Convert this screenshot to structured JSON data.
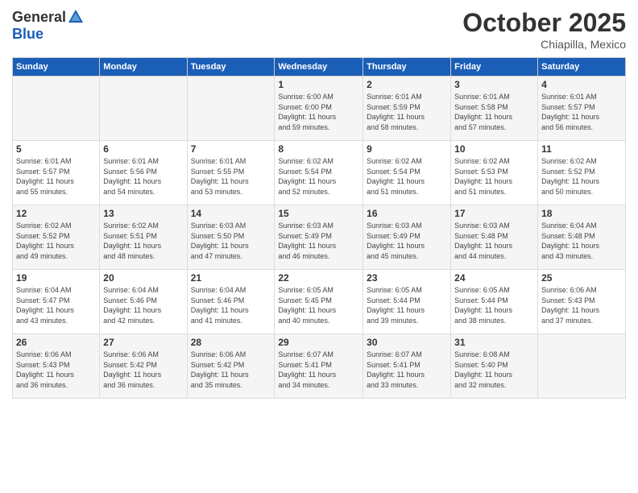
{
  "header": {
    "logo_general": "General",
    "logo_blue": "Blue",
    "month": "October 2025",
    "location": "Chiapilla, Mexico"
  },
  "weekdays": [
    "Sunday",
    "Monday",
    "Tuesday",
    "Wednesday",
    "Thursday",
    "Friday",
    "Saturday"
  ],
  "weeks": [
    [
      {
        "day": "",
        "info": ""
      },
      {
        "day": "",
        "info": ""
      },
      {
        "day": "",
        "info": ""
      },
      {
        "day": "1",
        "info": "Sunrise: 6:00 AM\nSunset: 6:00 PM\nDaylight: 11 hours\nand 59 minutes."
      },
      {
        "day": "2",
        "info": "Sunrise: 6:01 AM\nSunset: 5:59 PM\nDaylight: 11 hours\nand 58 minutes."
      },
      {
        "day": "3",
        "info": "Sunrise: 6:01 AM\nSunset: 5:58 PM\nDaylight: 11 hours\nand 57 minutes."
      },
      {
        "day": "4",
        "info": "Sunrise: 6:01 AM\nSunset: 5:57 PM\nDaylight: 11 hours\nand 56 minutes."
      }
    ],
    [
      {
        "day": "5",
        "info": "Sunrise: 6:01 AM\nSunset: 5:57 PM\nDaylight: 11 hours\nand 55 minutes."
      },
      {
        "day": "6",
        "info": "Sunrise: 6:01 AM\nSunset: 5:56 PM\nDaylight: 11 hours\nand 54 minutes."
      },
      {
        "day": "7",
        "info": "Sunrise: 6:01 AM\nSunset: 5:55 PM\nDaylight: 11 hours\nand 53 minutes."
      },
      {
        "day": "8",
        "info": "Sunrise: 6:02 AM\nSunset: 5:54 PM\nDaylight: 11 hours\nand 52 minutes."
      },
      {
        "day": "9",
        "info": "Sunrise: 6:02 AM\nSunset: 5:54 PM\nDaylight: 11 hours\nand 51 minutes."
      },
      {
        "day": "10",
        "info": "Sunrise: 6:02 AM\nSunset: 5:53 PM\nDaylight: 11 hours\nand 51 minutes."
      },
      {
        "day": "11",
        "info": "Sunrise: 6:02 AM\nSunset: 5:52 PM\nDaylight: 11 hours\nand 50 minutes."
      }
    ],
    [
      {
        "day": "12",
        "info": "Sunrise: 6:02 AM\nSunset: 5:52 PM\nDaylight: 11 hours\nand 49 minutes."
      },
      {
        "day": "13",
        "info": "Sunrise: 6:02 AM\nSunset: 5:51 PM\nDaylight: 11 hours\nand 48 minutes."
      },
      {
        "day": "14",
        "info": "Sunrise: 6:03 AM\nSunset: 5:50 PM\nDaylight: 11 hours\nand 47 minutes."
      },
      {
        "day": "15",
        "info": "Sunrise: 6:03 AM\nSunset: 5:49 PM\nDaylight: 11 hours\nand 46 minutes."
      },
      {
        "day": "16",
        "info": "Sunrise: 6:03 AM\nSunset: 5:49 PM\nDaylight: 11 hours\nand 45 minutes."
      },
      {
        "day": "17",
        "info": "Sunrise: 6:03 AM\nSunset: 5:48 PM\nDaylight: 11 hours\nand 44 minutes."
      },
      {
        "day": "18",
        "info": "Sunrise: 6:04 AM\nSunset: 5:48 PM\nDaylight: 11 hours\nand 43 minutes."
      }
    ],
    [
      {
        "day": "19",
        "info": "Sunrise: 6:04 AM\nSunset: 5:47 PM\nDaylight: 11 hours\nand 43 minutes."
      },
      {
        "day": "20",
        "info": "Sunrise: 6:04 AM\nSunset: 5:46 PM\nDaylight: 11 hours\nand 42 minutes."
      },
      {
        "day": "21",
        "info": "Sunrise: 6:04 AM\nSunset: 5:46 PM\nDaylight: 11 hours\nand 41 minutes."
      },
      {
        "day": "22",
        "info": "Sunrise: 6:05 AM\nSunset: 5:45 PM\nDaylight: 11 hours\nand 40 minutes."
      },
      {
        "day": "23",
        "info": "Sunrise: 6:05 AM\nSunset: 5:44 PM\nDaylight: 11 hours\nand 39 minutes."
      },
      {
        "day": "24",
        "info": "Sunrise: 6:05 AM\nSunset: 5:44 PM\nDaylight: 11 hours\nand 38 minutes."
      },
      {
        "day": "25",
        "info": "Sunrise: 6:06 AM\nSunset: 5:43 PM\nDaylight: 11 hours\nand 37 minutes."
      }
    ],
    [
      {
        "day": "26",
        "info": "Sunrise: 6:06 AM\nSunset: 5:43 PM\nDaylight: 11 hours\nand 36 minutes."
      },
      {
        "day": "27",
        "info": "Sunrise: 6:06 AM\nSunset: 5:42 PM\nDaylight: 11 hours\nand 36 minutes."
      },
      {
        "day": "28",
        "info": "Sunrise: 6:06 AM\nSunset: 5:42 PM\nDaylight: 11 hours\nand 35 minutes."
      },
      {
        "day": "29",
        "info": "Sunrise: 6:07 AM\nSunset: 5:41 PM\nDaylight: 11 hours\nand 34 minutes."
      },
      {
        "day": "30",
        "info": "Sunrise: 6:07 AM\nSunset: 5:41 PM\nDaylight: 11 hours\nand 33 minutes."
      },
      {
        "day": "31",
        "info": "Sunrise: 6:08 AM\nSunset: 5:40 PM\nDaylight: 11 hours\nand 32 minutes."
      },
      {
        "day": "",
        "info": ""
      }
    ]
  ]
}
